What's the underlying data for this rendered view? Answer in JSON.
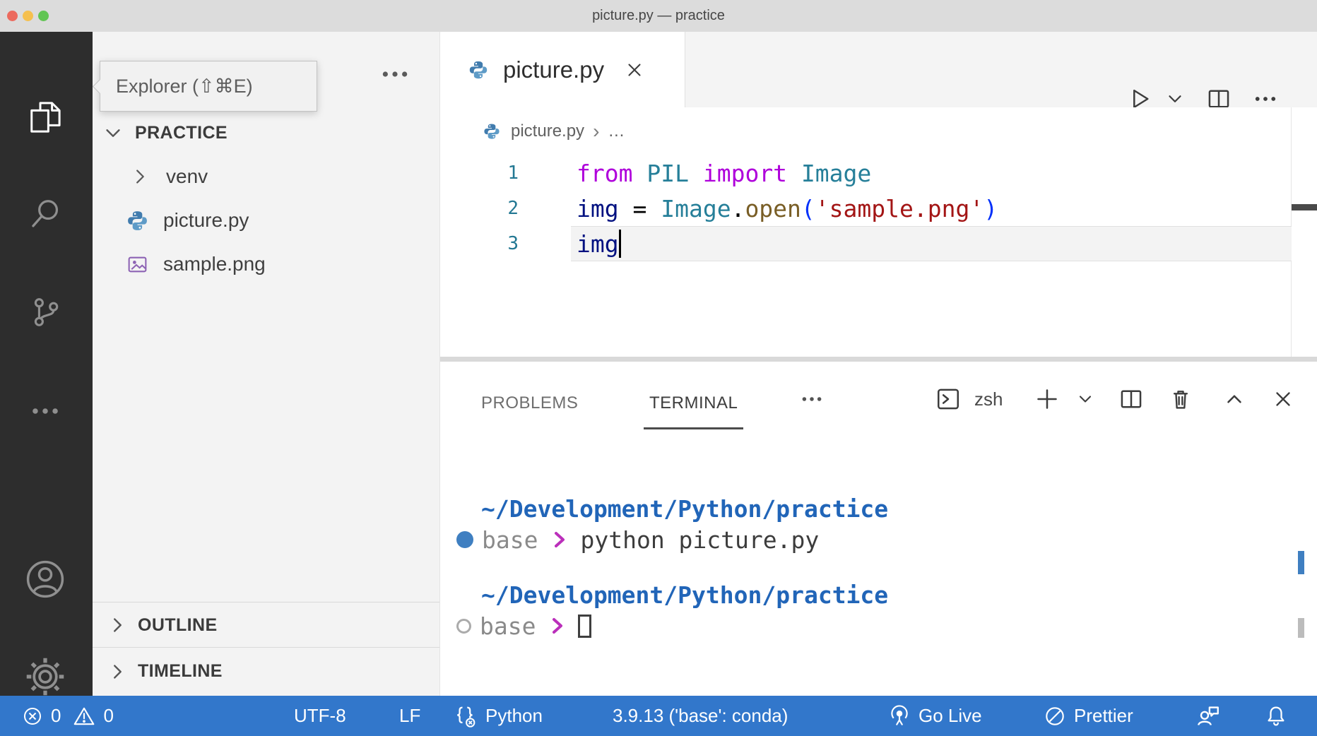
{
  "window": {
    "title": "picture.py — practice"
  },
  "tooltip": {
    "label": "Explorer (⇧⌘E)"
  },
  "activity_bar": {
    "items": [
      "explorer",
      "search",
      "source-control",
      "more",
      "account",
      "settings"
    ]
  },
  "sidebar": {
    "explorer_section": {
      "label": "PRACTICE"
    },
    "files": [
      {
        "name": "venv",
        "kind": "folder"
      },
      {
        "name": "picture.py",
        "kind": "python"
      },
      {
        "name": "sample.png",
        "kind": "image"
      }
    ],
    "bottom_sections": [
      {
        "label": "OUTLINE"
      },
      {
        "label": "TIMELINE"
      }
    ]
  },
  "editor": {
    "tab": "picture.py",
    "breadcrumb": {
      "file": "picture.py",
      "separator": "›",
      "ellipsis": "…"
    },
    "token_colors": {
      "keyword": "#af00db",
      "type": "#267f99",
      "variable": "#001080",
      "plain": "#000000",
      "function": "#795e26",
      "bracket": "#0431fa",
      "string": "#a31515"
    },
    "lines": [
      {
        "number": "1",
        "tokens": [
          {
            "text": "from",
            "color": "keyword"
          },
          {
            "text": " ",
            "color": "plain"
          },
          {
            "text": "PIL",
            "color": "type"
          },
          {
            "text": " ",
            "color": "plain"
          },
          {
            "text": "import",
            "color": "keyword"
          },
          {
            "text": " ",
            "color": "plain"
          },
          {
            "text": "Image",
            "color": "type"
          }
        ]
      },
      {
        "number": "2",
        "tokens": [
          {
            "text": "img",
            "color": "variable"
          },
          {
            "text": " = ",
            "color": "plain"
          },
          {
            "text": "Image",
            "color": "type"
          },
          {
            "text": ".",
            "color": "plain"
          },
          {
            "text": "open",
            "color": "function"
          },
          {
            "text": "(",
            "color": "bracket"
          },
          {
            "text": "'sample.png'",
            "color": "string"
          },
          {
            "text": ")",
            "color": "bracket"
          }
        ]
      },
      {
        "number": "3",
        "highlight": true,
        "cursor": true,
        "tokens": [
          {
            "text": "img",
            "color": "variable"
          }
        ]
      }
    ]
  },
  "panel": {
    "tabs": [
      {
        "label": "PROBLEMS",
        "active": false
      },
      {
        "label": "TERMINAL",
        "active": true
      }
    ],
    "shell_label": "zsh",
    "terminal": {
      "lines": [
        {
          "type": "path",
          "text": "~/Development/Python/practice"
        },
        {
          "type": "prompt",
          "marker": "filled",
          "env": "base",
          "arrow": "❯",
          "command": "python picture.py"
        },
        {
          "type": "path",
          "text": "~/Development/Python/practice"
        },
        {
          "type": "prompt",
          "marker": "hollow",
          "env": "base",
          "arrow": "❯",
          "command": "",
          "show_cursor": true
        }
      ]
    }
  },
  "status_bar": {
    "errors": "0",
    "warnings": "0",
    "encoding": "UTF-8",
    "eol": "LF",
    "language": "Python",
    "interpreter": "3.9.13 ('base': conda)",
    "go_live": "Go Live",
    "formatter": "Prettier"
  },
  "colors": {
    "status_bar_bg": "#3277cb",
    "traffic_red": "#ec6a5e",
    "traffic_yellow": "#f5c04f",
    "traffic_green": "#62c554",
    "terminal_path": "#2165b8",
    "prompt_arrow": "#bb2fbb",
    "activity_bar_bg": "#2d2d2d"
  }
}
